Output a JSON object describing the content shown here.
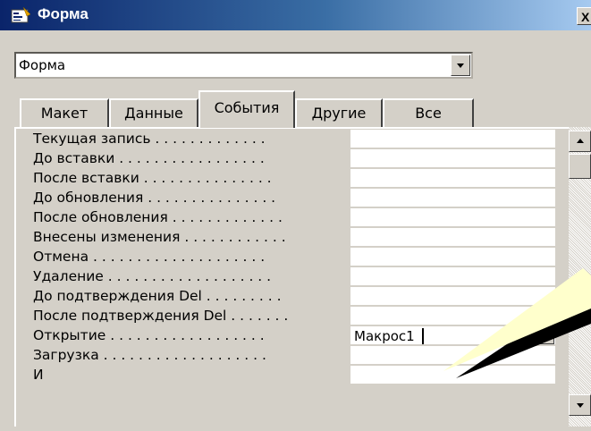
{
  "window": {
    "title": "Форма",
    "close_label": "X"
  },
  "object_selector": {
    "value": "Форма"
  },
  "tabs": [
    {
      "label": "Макет",
      "active": false
    },
    {
      "label": "Данные",
      "active": false
    },
    {
      "label": "События",
      "active": true
    },
    {
      "label": "Другие",
      "active": false
    },
    {
      "label": "Все",
      "active": false
    }
  ],
  "properties": [
    {
      "label": "Текущая запись . . . . . . . . . . . . .",
      "value": ""
    },
    {
      "label": "До вставки . . . . . . . . . . . . . . . . .",
      "value": ""
    },
    {
      "label": "После вставки . . . . . . . . . . . . . . .",
      "value": ""
    },
    {
      "label": "До обновления . . . . . . . . . . . . . . .",
      "value": ""
    },
    {
      "label": "После обновления . . . . . . . . . . . . .",
      "value": ""
    },
    {
      "label": "Внесены изменения . . . . . . . . . . . .",
      "value": ""
    },
    {
      "label": "Отмена . . . . . . . . . . . . . . . . . . . .",
      "value": ""
    },
    {
      "label": "Удаление . . . . . . . . . . . . . . . . . . .",
      "value": ""
    },
    {
      "label": "До подтверждения Del . . . . . . . . .",
      "value": ""
    },
    {
      "label": "После подтверждения Del . . . . . . .",
      "value": ""
    },
    {
      "label": "Открытие . . . . . . . . . . . . . . . . . .",
      "value": "Макрос1"
    },
    {
      "label": "Загрузка . . . . . . . . . . . . . . . . . . .",
      "value": ""
    },
    {
      "label": "И",
      "value": ""
    }
  ],
  "colors": {
    "title_start": "#0a246a",
    "title_end": "#a6caf0",
    "face": "#d4d0c8",
    "callout": "#ffffcc"
  }
}
